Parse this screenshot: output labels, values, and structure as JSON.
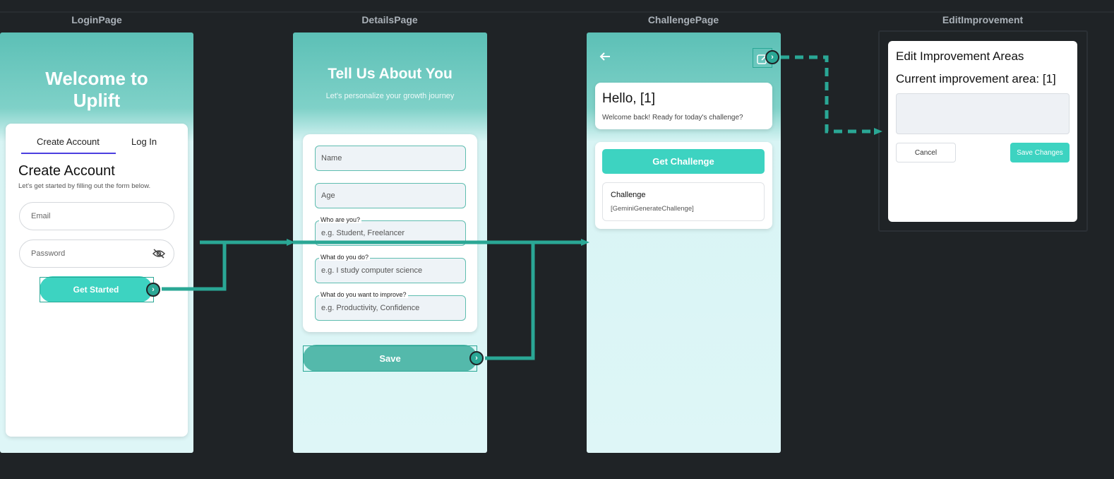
{
  "frames": {
    "login": {
      "label": "LoginPage"
    },
    "details": {
      "label": "DetailsPage"
    },
    "challenge": {
      "label": "ChallengePage"
    },
    "edit": {
      "label": "EditImprovement"
    }
  },
  "login": {
    "welcome_line1": "Welcome to",
    "welcome_line2": "Uplift",
    "tab_create": "Create Account",
    "tab_login": "Log In",
    "heading": "Create Account",
    "subheading": "Let's get started by filling out the form below.",
    "email_placeholder": "Email",
    "password_placeholder": "Password",
    "password_icon": "eye-off-icon",
    "submit_label": "Get Started"
  },
  "details": {
    "title": "Tell Us About You",
    "subtitle": "Let's personalize your growth journey",
    "name_placeholder": "Name",
    "age_placeholder": "Age",
    "who_label": "Who are you?",
    "who_placeholder": "e.g. Student, Freelancer",
    "do_label": "What do you do?",
    "do_placeholder": "e.g. I study computer science",
    "improve_label": "What do you want to improve?",
    "improve_placeholder": "e.g. Productivity, Confidence",
    "save_label": "Save"
  },
  "challenge": {
    "back_icon": "arrow-left-icon",
    "edit_icon": "edit-icon",
    "greeting": "Hello, [1]",
    "welcome_text": "Welcome back! Ready for today's challenge?",
    "get_challenge_label": "Get Challenge",
    "challenge_title": "Challenge",
    "challenge_value": "[GeminiGenerateChallenge]"
  },
  "edit": {
    "title": "Edit Improvement Areas",
    "current_label": "Current improvement area: [1]",
    "cancel_label": "Cancel",
    "save_label": "Save Changes"
  },
  "colors": {
    "canvas": "#1f2326",
    "accent": "#3dd3c1",
    "wire": "#2aa795",
    "tab_indicator": "#4b3fe0"
  }
}
